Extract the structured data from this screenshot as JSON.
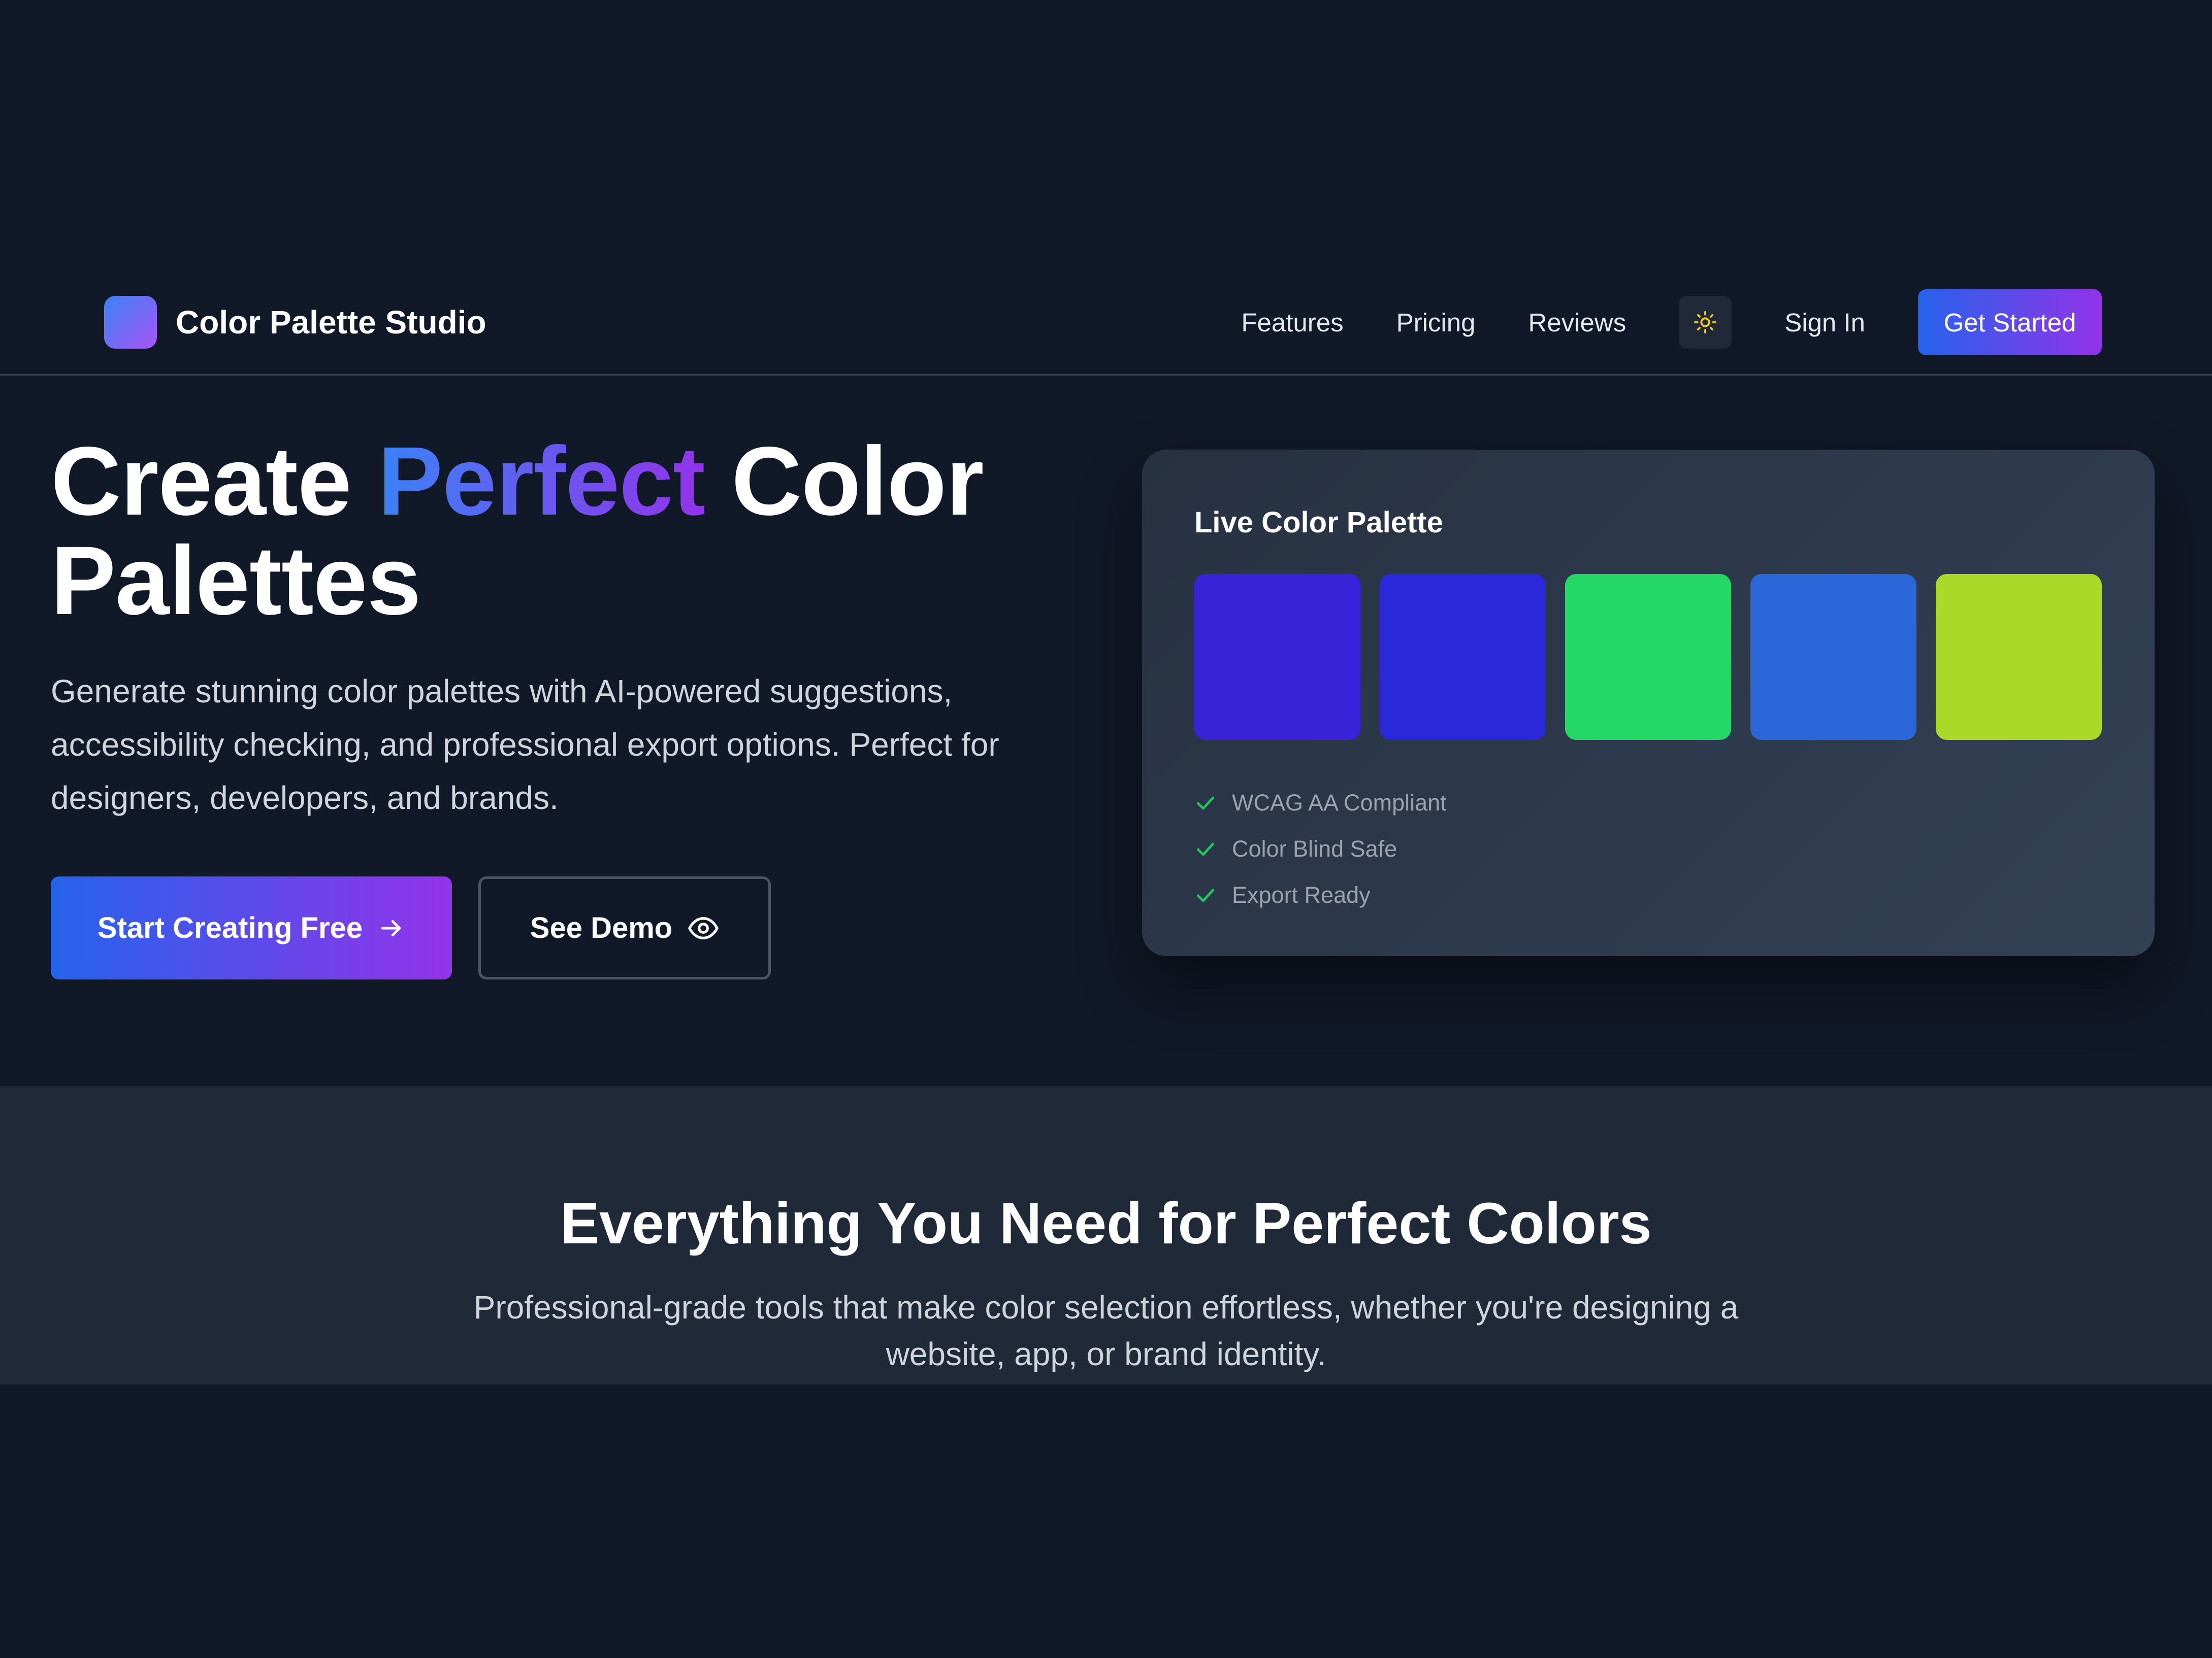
{
  "nav": {
    "brand": "Color Palette Studio",
    "links": [
      "Features",
      "Pricing",
      "Reviews"
    ],
    "theme_toggle_icon": "sun-icon",
    "sign_in": "Sign In",
    "get_started": "Get Started"
  },
  "hero": {
    "title_before": "Create ",
    "title_accent": "Perfect",
    "title_after": " Color",
    "title_line2": "Palettes",
    "subtitle": "Generate stunning color palettes with AI-powered suggestions, accessibility checking, and professional export options. Perfect for designers, developers, and brands.",
    "primary_cta": "Start Creating Free",
    "primary_cta_icon": "arrow-right-icon",
    "secondary_cta": "See Demo",
    "secondary_cta_icon": "eye-icon"
  },
  "palette_card": {
    "title": "Live Color Palette",
    "swatches": [
      "#3a22d9",
      "#2b27db",
      "#25d765",
      "#2b67d9",
      "#aad929"
    ],
    "features": [
      "WCAG AA Compliant",
      "Color Blind Safe",
      "Export Ready"
    ],
    "check_icon": "check-icon"
  },
  "features_section": {
    "title": "Everything You Need for Perfect Colors",
    "subtitle": "Professional-grade tools that make color selection effortless, whether you're designing a website, app, or brand identity."
  },
  "colors": {
    "background": "#111827",
    "section_background": "#1f2937",
    "accent_start": "#2563eb",
    "accent_end": "#9333ea",
    "check": "#22c55e",
    "sun": "#facc15"
  }
}
